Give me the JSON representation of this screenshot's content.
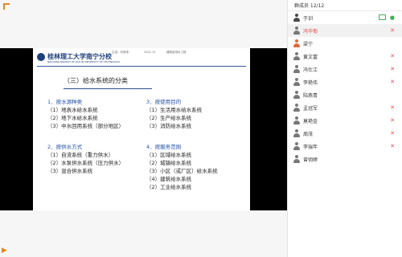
{
  "video": {
    "slide": {
      "logo_text": "桂林理工大学南宁分校",
      "logo_sub": "NAN NING BRANCH OF GUILIN UNIVERSITY OF TECHNOLOGY",
      "header_info": [
        "主讲：刘老师",
        "2021.12",
        "建筑给排水工程"
      ],
      "title": "（三）给水系统的分类",
      "left_column": [
        {
          "heading": "1．按水源种类",
          "items": [
            "（1）地表水给水系统",
            "（2）地下水给水系统",
            "（3）中水回用系统（部分地区）"
          ]
        },
        {
          "heading": "2．按供水方式",
          "items": [
            "（1）自流系统（重力供水）",
            "（2）水泵供水系统（压力供水）",
            "（3）混合供水系统"
          ]
        }
      ],
      "right_column": [
        {
          "heading": "3．按使用目的",
          "items": [
            "（1）生活用水给水系统",
            "（2）生产给水系统",
            "（3）消防给水系统"
          ]
        },
        {
          "heading": "4．按服务范围",
          "items": [
            "（1）区域给水系统",
            "（2）城镇给水系统",
            "（3）小区（或厂区）给水系统",
            "（4）建筑给水系统",
            "（2）工业给水系统"
          ]
        }
      ]
    }
  },
  "panel": {
    "title": "群成员 12/12",
    "members": [
      {
        "name": "于训",
        "role": "host",
        "mic": "green",
        "camera": true
      },
      {
        "name": "冯华甸",
        "active": true,
        "name_color": "red",
        "mic": "red"
      },
      {
        "name": "梁宁",
        "role": "accent"
      },
      {
        "name": "黄文富",
        "mic": "red"
      },
      {
        "name": "冯仕江",
        "mic": "red"
      },
      {
        "name": "李艳伟",
        "mic": "red"
      },
      {
        "name": "陆燕青"
      },
      {
        "name": "孟冠军",
        "mic": "red"
      },
      {
        "name": "莫艳金",
        "mic": "red"
      },
      {
        "name": "周茂",
        "mic": "red"
      },
      {
        "name": "李瑞年",
        "mic": "red"
      },
      {
        "name": "曾钥婷"
      }
    ]
  },
  "colors": {
    "accent_blue": "#2350a8",
    "orange": "#e0892a",
    "muted_red": "#e05252",
    "green": "#3fae4f"
  }
}
